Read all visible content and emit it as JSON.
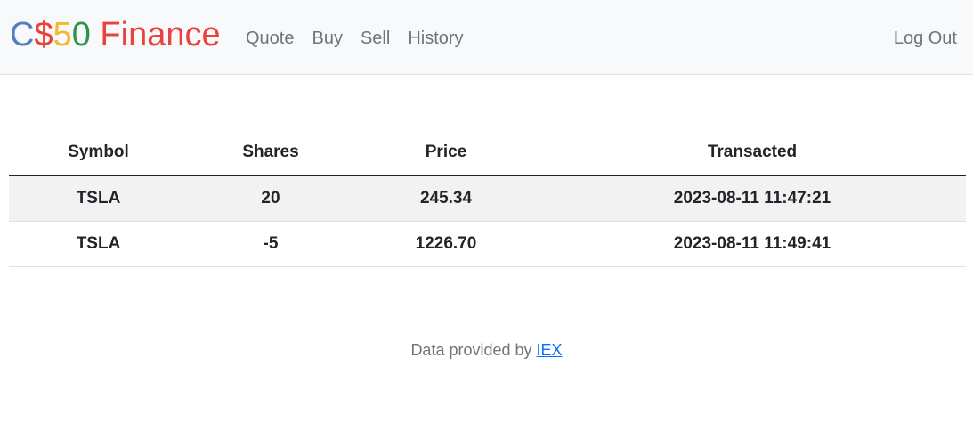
{
  "navbar": {
    "brand": {
      "part1": "C",
      "part2": "$",
      "part3": "5",
      "part4": "0",
      "part5": " Finance"
    },
    "links": [
      "Quote",
      "Buy",
      "Sell",
      "History"
    ],
    "logout": "Log Out"
  },
  "table": {
    "headers": [
      "Symbol",
      "Shares",
      "Price",
      "Transacted"
    ],
    "rows": [
      [
        "TSLA",
        "20",
        "245.34",
        "2023-08-11 11:47:21"
      ],
      [
        "TSLA",
        "-5",
        "1226.70",
        "2023-08-11 11:49:41"
      ]
    ]
  },
  "footer": {
    "text": "Data provided by ",
    "link": "IEX"
  },
  "colors": {
    "brand_blue": "#537fbe",
    "brand_red": "#ea433b",
    "brand_yellow": "#f5b82e",
    "brand_green": "#2e944b",
    "link": "#0d6efd"
  }
}
